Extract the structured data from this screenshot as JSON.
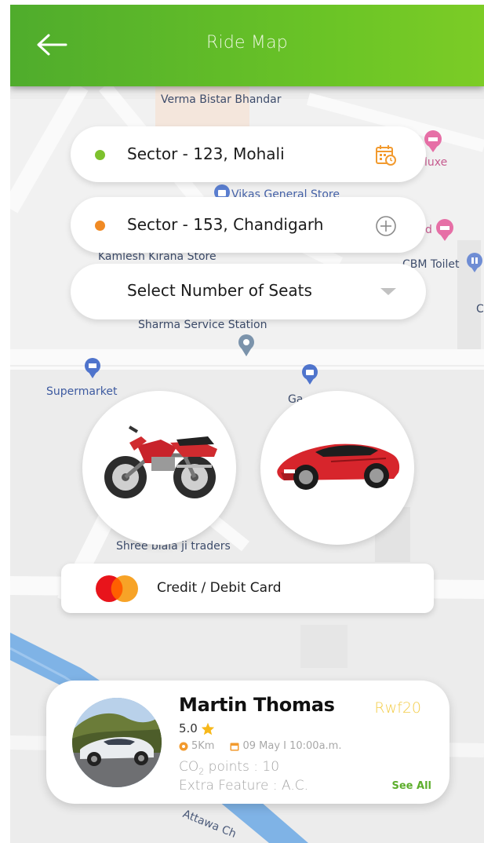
{
  "header": {
    "title": "Ride Map",
    "back_icon": "arrow-left-icon"
  },
  "map": {
    "labels": {
      "verma": "Verma Bistar Bhandar",
      "deluxe": "luxe",
      "vikas": "Vikas General Store",
      "d": "d",
      "kamlesh": "Kamlesh Kirana Store",
      "toilet": "CBM Toilet",
      "c": "C",
      "sharma": "Sharma Service Station",
      "supermarket": "Supermarket",
      "ga": "Ga",
      "shree": "Shree biala ji traders",
      "attawa": "Attawa Ch"
    }
  },
  "route": {
    "pickup": "Sector - 123, Mohali",
    "pickup_color": "#7dc12d",
    "pickup_icon": "calendar-clock-icon",
    "drop": "Sector - 153, Chandigarh",
    "drop_color": "#f08a24",
    "drop_icon": "plus-circle-icon",
    "seats_placeholder": "Select Number of Seats"
  },
  "vehicles": [
    {
      "name": "motorbike",
      "icon": "motorbike-icon"
    },
    {
      "name": "car",
      "icon": "car-icon"
    }
  ],
  "payment": {
    "label": "Credit / Debit Card",
    "icon": "mastercard-icon"
  },
  "driver": {
    "name": "Martin Thomas",
    "price": "Rwf20",
    "rating": "5.0",
    "distance": "5Km",
    "datetime": "09 May  I  10:00a.m.",
    "co2_prefix": "CO",
    "co2_sub": "2",
    "co2_suffix": " points : 10",
    "extra_feature": "Extra Feature : A.C.",
    "see_all": "See All"
  },
  "colors": {
    "accent_green": "#5fb62a",
    "price_yellow": "#f3cd4a",
    "calendar_orange": "#f29a2e"
  }
}
